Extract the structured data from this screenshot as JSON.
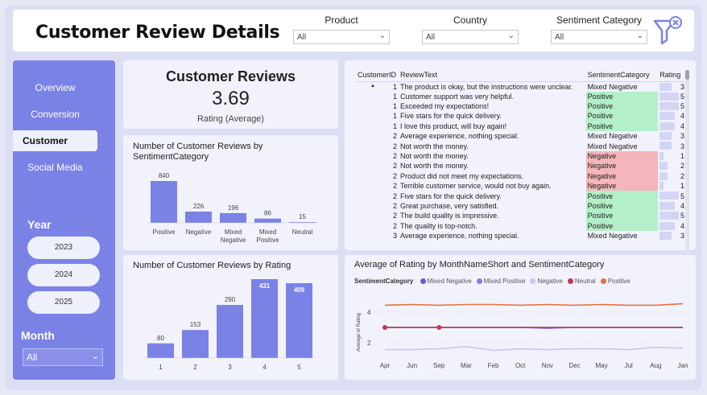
{
  "header": {
    "title": "Customer Review Details",
    "filters": [
      {
        "label": "Product",
        "value": "All"
      },
      {
        "label": "Country",
        "value": "All"
      },
      {
        "label": "Sentiment Category",
        "value": "All"
      }
    ],
    "clear_filters_icon": "filter-clear-icon"
  },
  "sidebar": {
    "nav": [
      "Overview",
      "Conversion",
      "Customer",
      "Social Media"
    ],
    "active": "Customer",
    "year_label": "Year",
    "years": [
      "2023",
      "2024",
      "2025"
    ],
    "month_label": "Month",
    "month_value": "All"
  },
  "kpi": {
    "title": "Customer Reviews",
    "value": "3.69",
    "subtitle": "Rating (Average)"
  },
  "colors": {
    "accent": "#7b82e6",
    "positive": "#b3efc8",
    "negative": "#f4b5bb",
    "mixed_negative": "#6a5bd6",
    "mixed_positive": "#7b82e6",
    "negative_line": "#c5c6f2",
    "neutral": "#c0394b",
    "positive_line": "#e0733f"
  },
  "table": {
    "headers": [
      "CustomerID",
      "ReviewText",
      "SentimentCategory",
      "Rating"
    ],
    "rows": [
      [
        "1",
        "The product is okay, but the instructions were unclear.",
        "Mixed Negative",
        "3"
      ],
      [
        "1",
        "Customer support was very helpful.",
        "Positive",
        "5"
      ],
      [
        "1",
        "Exceeded my expectations!",
        "Positive",
        "5"
      ],
      [
        "1",
        "Five stars for the quick delivery.",
        "Positive",
        "4"
      ],
      [
        "1",
        "I love this product, will buy again!",
        "Positive",
        "4"
      ],
      [
        "2",
        "Average experience, nothing special.",
        "Mixed Negative",
        "3"
      ],
      [
        "2",
        "Not worth the money.",
        "Mixed Negative",
        "3"
      ],
      [
        "2",
        "Not worth the money.",
        "Negative",
        "1"
      ],
      [
        "2",
        "Not worth the money.",
        "Negative",
        "2"
      ],
      [
        "2",
        "Product did not meet my expectations.",
        "Negative",
        "2"
      ],
      [
        "2",
        "Terrible customer service, would not buy again.",
        "Negative",
        "1"
      ],
      [
        "2",
        "Five stars for the quick delivery.",
        "Positive",
        "5"
      ],
      [
        "2",
        "Great purchase, very satisfied.",
        "Positive",
        "4"
      ],
      [
        "2",
        "The build quality is impressive.",
        "Positive",
        "5"
      ],
      [
        "2",
        "The quality is top-notch.",
        "Positive",
        "4"
      ],
      [
        "3",
        "Average experience, nothing special.",
        "Mixed Negative",
        "3"
      ]
    ]
  },
  "chart_data": [
    {
      "type": "bar",
      "title": "Number of Customer Reviews by SentimentCategory",
      "categories": [
        "Positive",
        "Negative",
        "Mixed Negative",
        "Mixed Positive",
        "Neutral"
      ],
      "values": [
        840,
        226,
        196,
        86,
        15
      ],
      "data_labels": true
    },
    {
      "type": "bar",
      "title": "Number of Customer Reviews by Rating",
      "categories": [
        "1",
        "2",
        "3",
        "4",
        "5"
      ],
      "values": [
        80,
        153,
        290,
        431,
        409
      ],
      "data_labels": true
    },
    {
      "type": "line",
      "title": "Average of Rating by MonthNameShort and SentimentCategory",
      "legend_title": "SentimentCategory",
      "ylabel": "Average of Rating",
      "x": [
        "Apr",
        "Jun",
        "Sep",
        "Mar",
        "Feb",
        "Oct",
        "Nov",
        "Dec",
        "May",
        "Jul",
        "Aug",
        "Jan"
      ],
      "yticks": [
        2,
        4
      ],
      "ylim": [
        1,
        5
      ],
      "series": [
        {
          "name": "Mixed Negative",
          "color": "#6a5bd6",
          "values": [
            3,
            3,
            3,
            3,
            3,
            3,
            2.95,
            3,
            3,
            3,
            3,
            3
          ]
        },
        {
          "name": "Mixed Positive",
          "color": "#7b82e6",
          "values": [
            3,
            3,
            3,
            3,
            3,
            3,
            3,
            3,
            3,
            3,
            3,
            3
          ]
        },
        {
          "name": "Negative",
          "color": "#c5c6f2",
          "values": [
            1.55,
            1.55,
            1.6,
            1.75,
            1.5,
            1.6,
            1.55,
            1.6,
            1.6,
            1.55,
            1.7,
            1.65
          ]
        },
        {
          "name": "Neutral",
          "color": "#c0394b",
          "values": [
            3,
            null,
            3,
            null,
            null,
            3,
            3,
            3,
            3,
            3,
            3,
            3
          ]
        },
        {
          "name": "Positive",
          "color": "#e0733f",
          "values": [
            4.45,
            4.5,
            4.45,
            4.5,
            4.5,
            4.45,
            4.5,
            4.45,
            4.5,
            4.45,
            4.45,
            4.55
          ]
        }
      ]
    }
  ]
}
